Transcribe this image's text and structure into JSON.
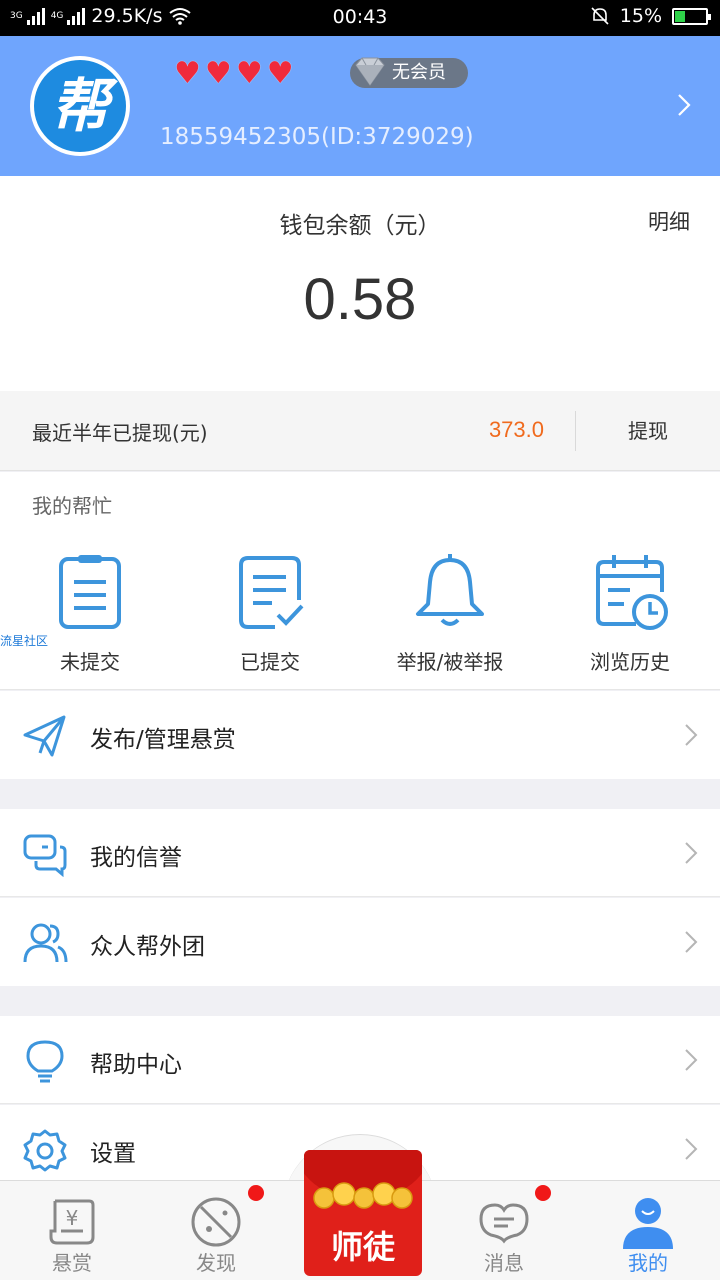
{
  "status_bar": {
    "net_left": "3G",
    "net_right": "4G",
    "speed": "29.5K/s",
    "time": "00:43",
    "battery": "15%"
  },
  "profile": {
    "logo_char": "帮",
    "hearts": [
      "♥",
      "♥",
      "♥",
      "♥"
    ],
    "vip_label": "无会员",
    "phone_id": "18559452305(ID:3729029)"
  },
  "wallet": {
    "title": "钱包余额（元）",
    "detail_label": "明细",
    "balance": "0.58"
  },
  "withdrawn": {
    "label": "最近半年已提现(元)",
    "amount": "373.0",
    "button": "提现"
  },
  "my_help": {
    "title": "我的帮忙",
    "watermark": "流星社区",
    "items": [
      {
        "label": "未提交",
        "icon": "clipboard-icon"
      },
      {
        "label": "已提交",
        "icon": "checked-document-icon"
      },
      {
        "label": "举报/被举报",
        "icon": "bell-icon"
      },
      {
        "label": "浏览历史",
        "icon": "calendar-clock-icon"
      }
    ]
  },
  "menu": {
    "publish": "发布/管理悬赏",
    "credit": "我的信誉",
    "team": "众人帮外团",
    "help_center": "帮助中心",
    "settings": "设置"
  },
  "bottom_nav": {
    "items": [
      {
        "label": "悬赏",
        "icon": "scroll-yen-icon"
      },
      {
        "label": "发现",
        "icon": "planet-icon"
      },
      {
        "label": "消息",
        "icon": "chat-heart-icon"
      },
      {
        "label": "我的",
        "icon": "person-icon"
      }
    ],
    "center_label": "师徒"
  },
  "colors": {
    "header_bg": "#6fa5fd",
    "accent_blue": "#3f8ef0",
    "amount_orange": "#f06a1d",
    "badge_red": "#f01818"
  }
}
